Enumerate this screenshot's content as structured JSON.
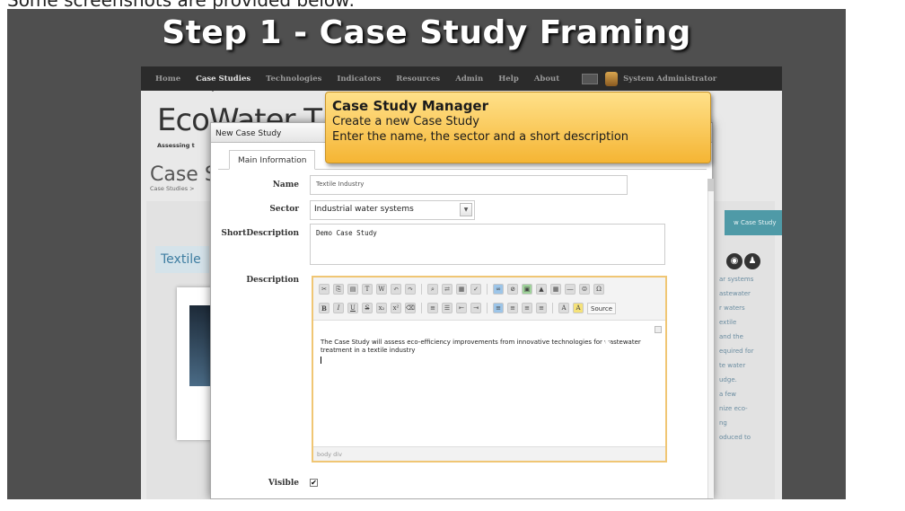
{
  "top_caption": "Some screenshots are provided below:",
  "slide_title": "Step 1 - Case Study Framing",
  "nav": {
    "items": [
      "Home",
      "Case Studies",
      "Technologies",
      "Indicators",
      "Resources",
      "Admin",
      "Help",
      "About"
    ],
    "active": "Case Studies",
    "user": "System Administrator"
  },
  "brand": {
    "name": "EcoWater T",
    "sub": "Assessing t"
  },
  "page": {
    "title": "Case S",
    "breadcrumb": "Case Studies >"
  },
  "textile_label": "Textile",
  "new_case_button": "w Case Study",
  "sidebar_texts": [
    "ar systems",
    "astewater",
    "r waters",
    "extile",
    "and the",
    "equired for",
    "te water",
    "udge.",
    "a few",
    "nize eco-",
    "ng",
    "oduced to"
  ],
  "dialog": {
    "title": "New Case Study",
    "tab": "Main Information",
    "name_label": "Name",
    "name_value": "Textile Industry",
    "sector_label": "Sector",
    "sector_value": "Industrial water systems",
    "short_label": "ShortDescription",
    "short_value": "Demo Case Study",
    "desc_label": "Description",
    "desc_text": "The Case Study will assess eco-efficiency improvements from innovative technologies for wastewater treatment in a textile industry",
    "editor_status": "body  div",
    "source_label": "Source",
    "visible_label": "Visible",
    "visible_checked": "✔"
  },
  "callout": {
    "title": "Case Study Manager",
    "line1": "Create a new Case Study",
    "line2": "Enter the name, the sector and a short description"
  },
  "colors": {
    "callout": "#f5b534",
    "nav_bg": "#2b2b2b",
    "slide_bg": "#4f4f4f",
    "accent": "#4f9aa7"
  }
}
